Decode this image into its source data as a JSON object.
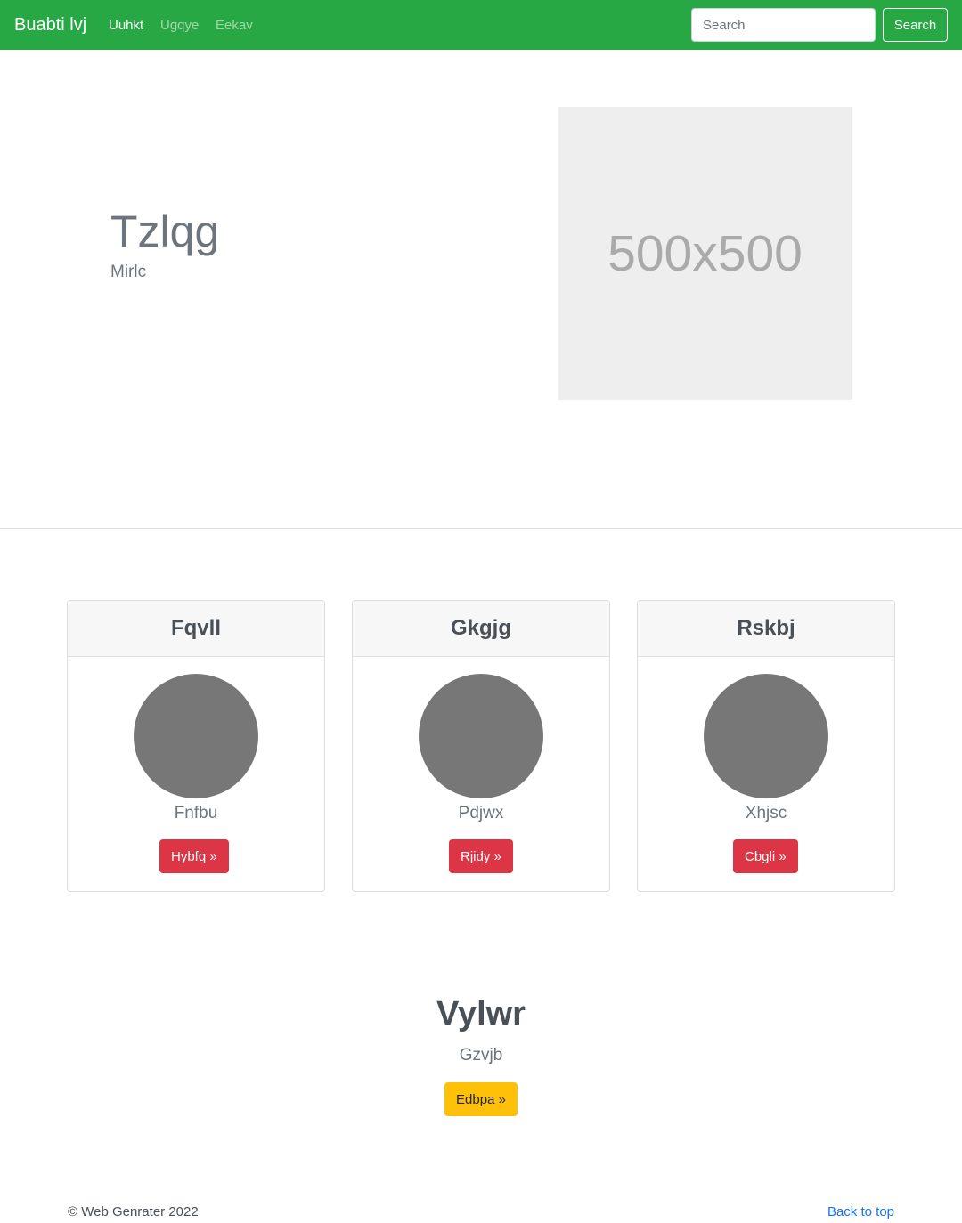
{
  "navbar": {
    "brand": "Buabti lvj",
    "links": [
      {
        "label": "Uuhkt",
        "active": true
      },
      {
        "label": "Ugqye",
        "active": false
      },
      {
        "label": "Eekav",
        "active": false
      }
    ],
    "search": {
      "placeholder": "Search",
      "value": "",
      "button_label": "Search"
    },
    "color": "#28a745"
  },
  "hero": {
    "title": "Tzlqg",
    "subtitle": "Mirlc",
    "image_label": "500x500"
  },
  "cards": [
    {
      "title": "Fqvll",
      "text": "Fnfbu",
      "button_label": "Hybfq »"
    },
    {
      "title": "Gkgjg",
      "text": "Pdjwx",
      "button_label": "Rjidy »"
    },
    {
      "title": "Rskbj",
      "text": "Xhjsc",
      "button_label": "Cbgli »"
    }
  ],
  "cta": {
    "title": "Vylwr",
    "subtitle": "Gzvjb",
    "button_label": "Edbpa »"
  },
  "footer": {
    "copyright": "© Web Genrater 2022",
    "back_to_top": "Back to top"
  },
  "colors": {
    "primary_nav": "#28a745",
    "danger": "#dc3545",
    "warning": "#ffc107",
    "link": "#1a73e8"
  }
}
